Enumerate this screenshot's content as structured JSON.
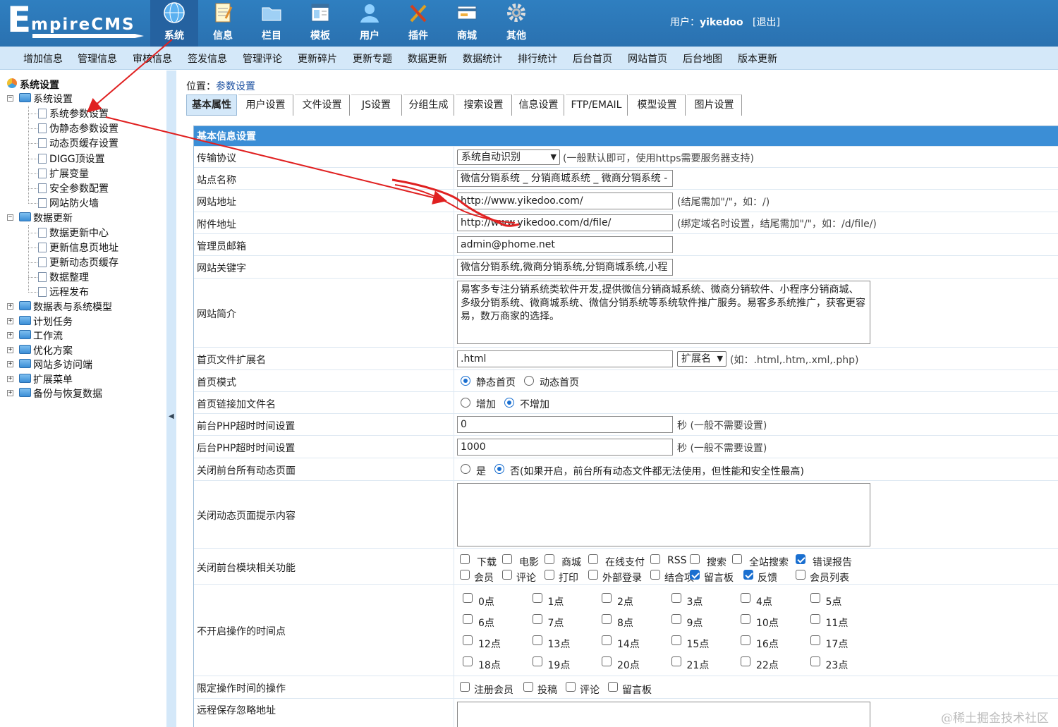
{
  "header": {
    "logo_initial": "E",
    "logo_rest": "mpireCMS",
    "main_tabs": [
      {
        "label": "系统",
        "icon": "globe-icon"
      },
      {
        "label": "信息",
        "icon": "notepad-icon"
      },
      {
        "label": "栏目",
        "icon": "folder-icon"
      },
      {
        "label": "模板",
        "icon": "template-icon"
      },
      {
        "label": "用户",
        "icon": "user-icon"
      },
      {
        "label": "插件",
        "icon": "tools-icon"
      },
      {
        "label": "商城",
        "icon": "card-icon"
      },
      {
        "label": "其他",
        "icon": "gear-icon"
      }
    ],
    "user_prefix": "用户：",
    "username": "yikedoo",
    "logout": "[退出]"
  },
  "subnav": [
    "增加信息",
    "管理信息",
    "审核信息",
    "签发信息",
    "管理评论",
    "更新碎片",
    "更新专题",
    "数据更新",
    "数据统计",
    "排行统计",
    "后台首页",
    "网站首页",
    "后台地图",
    "版本更新"
  ],
  "tree": {
    "root": "系统设置",
    "g1": "系统设置",
    "g1_items": [
      "系统参数设置",
      "伪静态参数设置",
      "动态页缓存设置",
      "DIGG顶设置",
      "扩展变量",
      "安全参数配置",
      "网站防火墙"
    ],
    "g2": "数据更新",
    "g2_items": [
      "数据更新中心",
      "更新信息页地址",
      "更新动态页缓存",
      "数据整理",
      "远程发布"
    ],
    "groups": [
      "数据表与系统模型",
      "计划任务",
      "工作流",
      "优化方案",
      "网站多访问端",
      "扩展菜单",
      "备份与恢复数据"
    ]
  },
  "main": {
    "crumb_prefix": "位置：",
    "crumb_link": "参数设置",
    "tabs": [
      "基本属性",
      "用户设置",
      "文件设置",
      "JS设置",
      "分组生成",
      "搜索设置",
      "信息设置",
      "FTP/EMAIL",
      "模型设置",
      "图片设置"
    ],
    "section_title": "基本信息设置"
  },
  "form": {
    "protocol_label": "传输协议",
    "protocol_value": "系统自动识别",
    "protocol_note": "(一般默认即可，使用https需要服务器支持)",
    "sitename_label": "站点名称",
    "sitename_value": "微信分销系统 _ 分销商城系统 _ 微商分销系统 -",
    "siteurl_label": "网站地址",
    "siteurl_value": "http://www.yikedoo.com/",
    "siteurl_note": "(结尾需加\"/\"，如：/)",
    "fileurl_label": "附件地址",
    "fileurl_value": "http://www.yikedoo.com/d/file/",
    "fileurl_note": "(绑定域名时设置，结尾需加\"/\"，如：/d/file/)",
    "email_label": "管理员邮箱",
    "email_value": "admin@phome.net",
    "keywords_label": "网站关键字",
    "keywords_value": "微信分销系统,微商分销系统,分销商城系统,小程",
    "intro_label": "网站简介",
    "intro_value": "易客多专注分销系统类软件开发,提供微信分销商城系统、微商分销软件、小程序分销商城、多级分销系统、微商城系统、微信分销系统等系统软件推广服务。易客多系统推广，获客更容易，数万商家的选择。",
    "ext_label": "首页文件扩展名",
    "ext_value": ".html",
    "ext_select": "扩展名",
    "ext_note": "(如：.html,.htm,.xml,.php)",
    "mode_label": "首页模式",
    "mode_static": "静态首页",
    "mode_dynamic": "动态首页",
    "link_label": "首页链接加文件名",
    "link_add": "增加",
    "link_noadd": "不增加",
    "front_timeout_label": "前台PHP超时时间设置",
    "front_timeout_value": "0",
    "timeout_note": "秒 (一般不需要设置)",
    "back_timeout_label": "后台PHP超时时间设置",
    "back_timeout_value": "1000",
    "close_dyn_label": "关闭前台所有动态页面",
    "close_yes": "是",
    "close_no": "否(如果开启，前台所有动态文件都无法使用，但性能和安全性最高)",
    "close_msg_label": "关闭动态页面提示内容",
    "close_modules_label": "关闭前台模块相关功能",
    "modules_row1": [
      {
        "label": "下载",
        "checked": false
      },
      {
        "label": "电影",
        "checked": false
      },
      {
        "label": "商城",
        "checked": false
      },
      {
        "label": "在线支付",
        "checked": false
      },
      {
        "label": "RSS",
        "checked": false
      },
      {
        "label": "搜索",
        "checked": false
      },
      {
        "label": "全站搜索",
        "checked": false
      },
      {
        "label": "错误报告",
        "checked": true
      }
    ],
    "modules_row2": [
      {
        "label": "会员",
        "checked": false
      },
      {
        "label": "评论",
        "checked": false
      },
      {
        "label": "打印",
        "checked": false
      },
      {
        "label": "外部登录",
        "checked": false
      },
      {
        "label": "结合项",
        "checked": false
      },
      {
        "label": "留言板",
        "checked": true
      },
      {
        "label": "反馈",
        "checked": true
      },
      {
        "label": "会员列表",
        "checked": false
      }
    ],
    "hours_label": "不开启操作的时间点",
    "hours": [
      "0点",
      "1点",
      "2点",
      "3点",
      "4点",
      "5点",
      "6点",
      "7点",
      "8点",
      "9点",
      "10点",
      "11点",
      "12点",
      "13点",
      "14点",
      "15点",
      "16点",
      "17点",
      "18点",
      "19点",
      "20点",
      "21点",
      "22点",
      "23点"
    ],
    "limit_label": "限定操作时间的操作",
    "limit_ops": [
      "注册会员",
      "投稿",
      "评论",
      "留言板"
    ],
    "remote_label": "远程保存忽略地址"
  },
  "watermark": "@稀土掘金技术社区",
  "colors": {
    "topbar": "#2f7fc0",
    "subnav": "#d4e8f9",
    "section_header": "#3b8ed6",
    "annotation": "#e02020"
  }
}
